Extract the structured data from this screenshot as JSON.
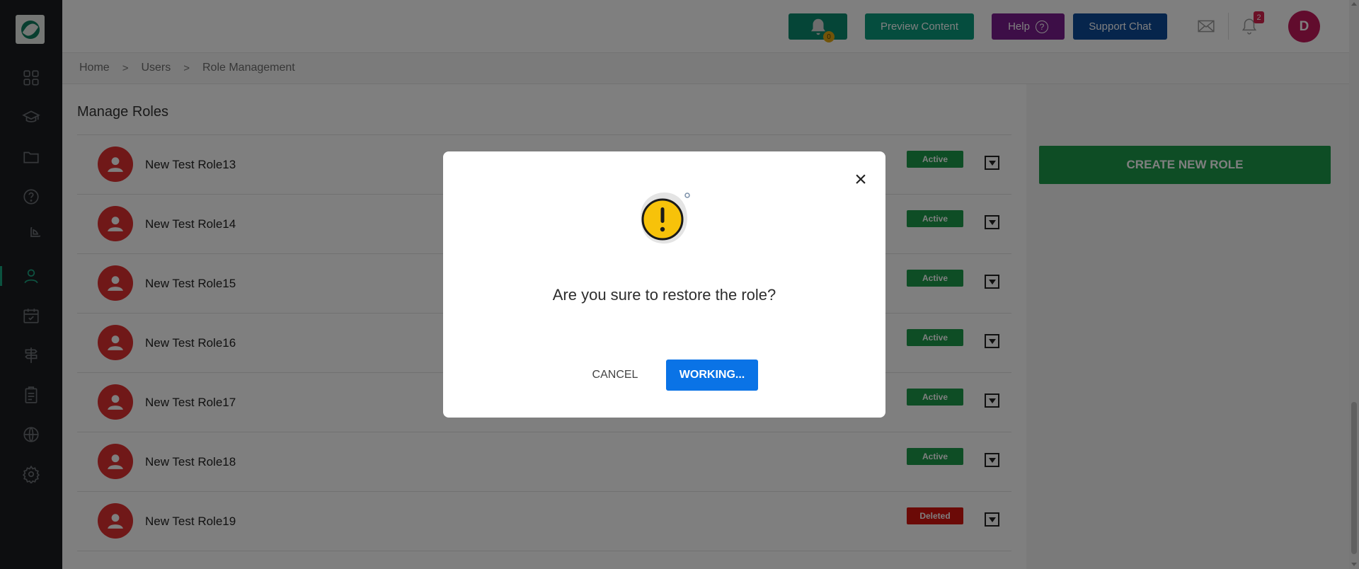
{
  "header": {
    "bell_count": "0",
    "preview_label": "Preview Content",
    "help_label": "Help",
    "help_icon_glyph": "?",
    "support_label": "Support Chat",
    "notification_count": "2",
    "avatar_initial": "D"
  },
  "breadcrumb": {
    "items": [
      "Home",
      "Users",
      "Role Management"
    ],
    "separator": ">"
  },
  "page": {
    "title": "Manage Roles",
    "create_button": "CREATE NEW ROLE"
  },
  "roles": [
    {
      "name": "New Test Role13",
      "status": "Active"
    },
    {
      "name": "New Test Role14",
      "status": "Active"
    },
    {
      "name": "New Test Role15",
      "status": "Active"
    },
    {
      "name": "New Test Role16",
      "status": "Active"
    },
    {
      "name": "New Test Role17",
      "status": "Active"
    },
    {
      "name": "New Test Role18",
      "status": "Active"
    },
    {
      "name": "New Test Role19",
      "status": "Deleted"
    }
  ],
  "modal": {
    "close_glyph": "×",
    "message": "Are you sure to restore the role?",
    "cancel_label": "CANCEL",
    "confirm_label": "WORKING..."
  },
  "colors": {
    "sidebar_bg": "#1b1d20",
    "accent_green": "#1d9a4a",
    "deleted_red": "#d7150e",
    "primary_blue": "#0a73e6",
    "avatar_pink": "#c2185b"
  },
  "icons": {
    "sidebar": [
      "dashboard-icon",
      "graduation-cap-icon",
      "folder-icon",
      "help-circle-icon",
      "pie-chart-icon",
      "users-icon",
      "calendar-check-icon",
      "signpost-icon",
      "clipboard-icon",
      "globe-icon",
      "settings-icon"
    ],
    "header": [
      "bell-icon",
      "mail-icon",
      "notification-bell-icon"
    ],
    "modal": "warning-icon"
  }
}
